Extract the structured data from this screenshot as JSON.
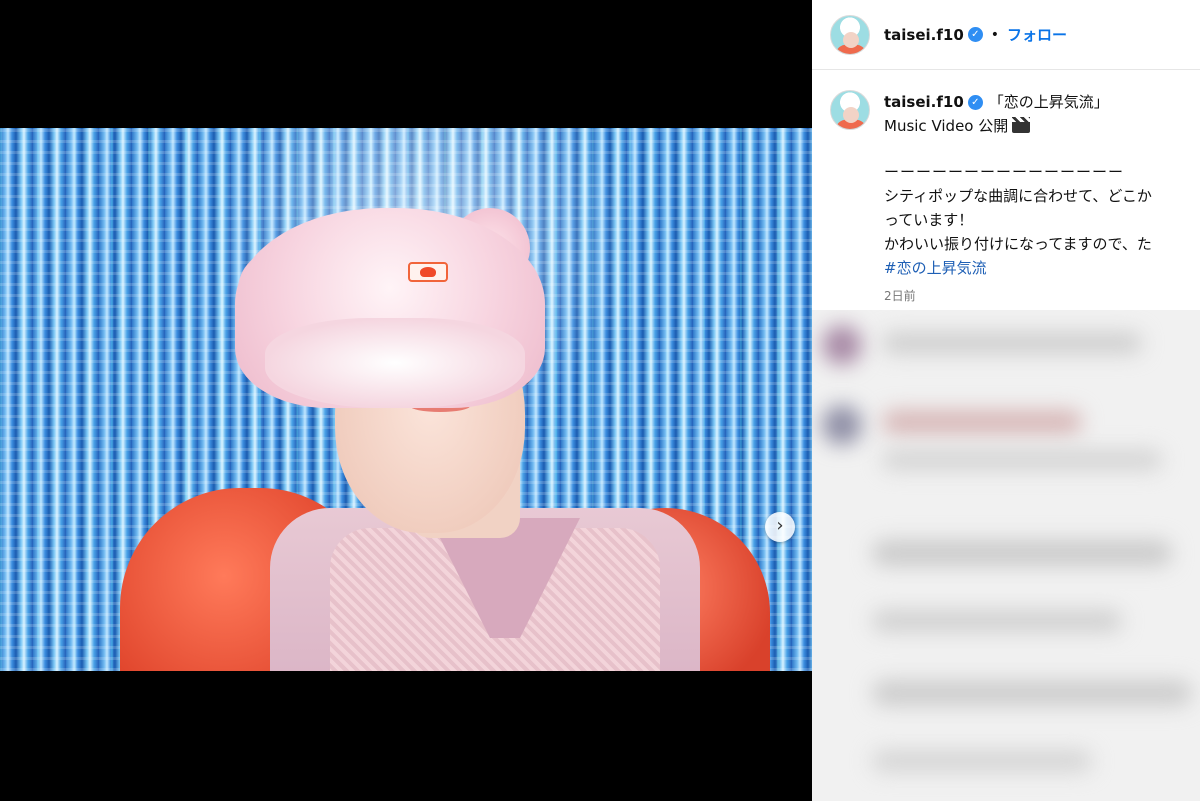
{
  "post_header": {
    "username": "taisei.f10",
    "separator": "•",
    "follow_label": "フォロー"
  },
  "post": {
    "username": "taisei.f10",
    "caption_title": "「恋の上昇気流」",
    "caption_line2": "Music Video 公開",
    "divider": "ーーーーーーーーーーーーーーー",
    "body_line1": "シティポップな曲調に合わせて、どこか",
    "body_line2": "っています！",
    "body_line3": "かわいい振り付けになってますので、た",
    "hashtag": "#恋の上昇気流",
    "timestamp": "2日前"
  },
  "media": {
    "next_icon": "›",
    "carousel_dots": 2,
    "active_dot": 0
  },
  "colors": {
    "link_blue": "#0a74e8",
    "hashtag_blue": "#1e5fb5",
    "verified_blue": "#2f8ef3"
  }
}
